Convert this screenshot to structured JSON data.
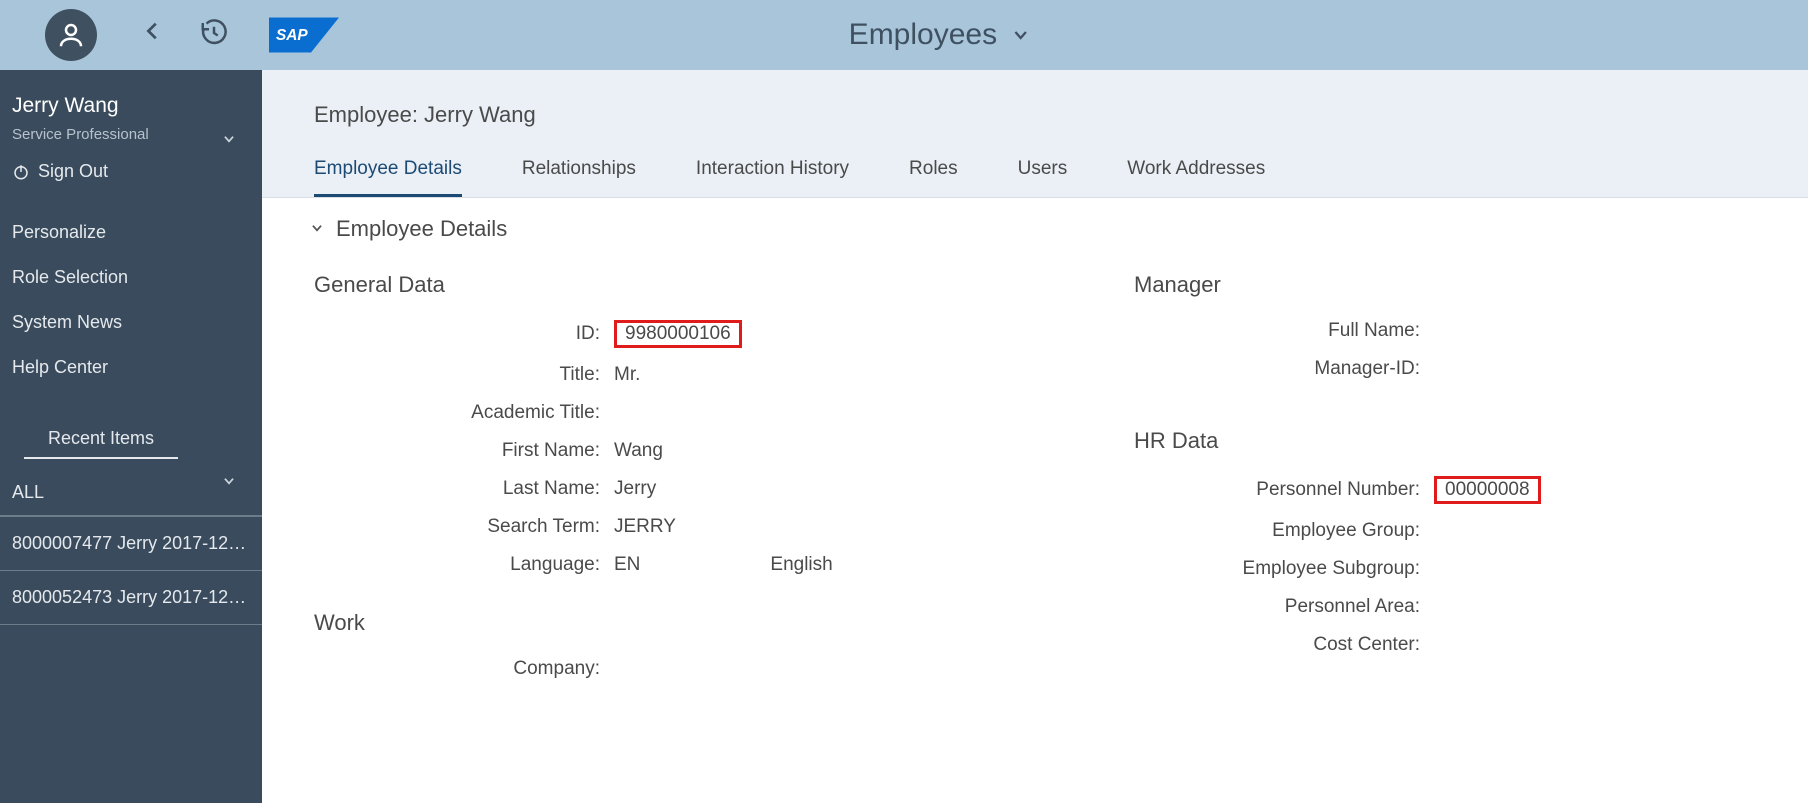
{
  "header": {
    "title": "Employees"
  },
  "sidebar": {
    "user_name": "Jerry Wang",
    "user_role": "Service Professional",
    "sign_out": "Sign Out",
    "nav": [
      "Personalize",
      "Role Selection",
      "System News",
      "Help Center"
    ],
    "recent_label": "Recent Items",
    "filter_label": "ALL",
    "recent_items": [
      "8000007477 Jerry 2017-12-2…",
      "8000052473 Jerry 2017-12-2…"
    ]
  },
  "content": {
    "title": "Employee: Jerry Wang",
    "tabs": [
      "Employee Details",
      "Relationships",
      "Interaction History",
      "Roles",
      "Users",
      "Work Addresses"
    ],
    "section_title": "Employee Details",
    "groups": {
      "general": {
        "title": "General Data",
        "fields": {
          "id_label": "ID:",
          "id_value": "9980000106",
          "title_label": "Title:",
          "title_value": "Mr.",
          "academic_label": "Academic Title:",
          "academic_value": "",
          "first_name_label": "First Name:",
          "first_name_value": "Wang",
          "last_name_label": "Last Name:",
          "last_name_value": "Jerry",
          "search_term_label": "Search Term:",
          "search_term_value": "JERRY",
          "language_label": "Language:",
          "language_value": "EN",
          "language_desc": "English"
        }
      },
      "work": {
        "title": "Work",
        "company_label": "Company:",
        "company_value": ""
      },
      "manager": {
        "title": "Manager",
        "full_name_label": "Full Name:",
        "full_name_value": "",
        "manager_id_label": "Manager-ID:",
        "manager_id_value": ""
      },
      "hr": {
        "title": "HR Data",
        "personnel_no_label": "Personnel Number:",
        "personnel_no_value": "00000008",
        "emp_group_label": "Employee Group:",
        "emp_group_value": "",
        "emp_subgroup_label": "Employee Subgroup:",
        "emp_subgroup_value": "",
        "personnel_area_label": "Personnel Area:",
        "personnel_area_value": "",
        "cost_center_label": "Cost Center:",
        "cost_center_value": ""
      }
    }
  }
}
